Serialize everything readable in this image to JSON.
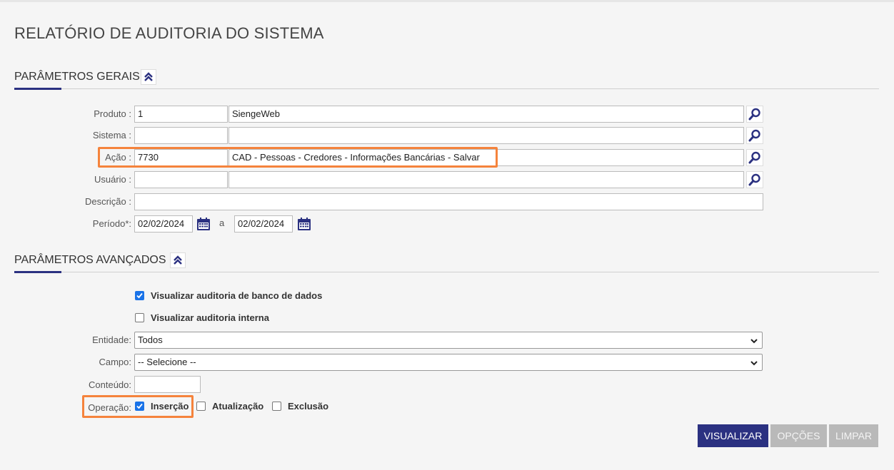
{
  "page": {
    "title": "RELATÓRIO DE AUDITORIA DO SISTEMA"
  },
  "general": {
    "title": "PARÂMETROS GERAIS",
    "produto": {
      "label": "Produto :",
      "code": "1",
      "name": "SiengeWeb"
    },
    "sistema": {
      "label": "Sistema :",
      "code": "",
      "name": ""
    },
    "acao": {
      "label": "Ação :",
      "code": "7730",
      "name": "CAD - Pessoas - Credores - Informações Bancárias - Salvar"
    },
    "usuario": {
      "label": "Usuário :",
      "code": "",
      "name": ""
    },
    "descricao": {
      "label": "Descrição :",
      "value": ""
    },
    "periodo": {
      "label": "Período*:",
      "start": "02/02/2024",
      "separator": "a",
      "end": "02/02/2024"
    }
  },
  "advanced": {
    "title": "PARÂMETROS AVANÇADOS",
    "db_audit": {
      "label": "Visualizar auditoria de banco de dados",
      "checked": true
    },
    "internal_audit": {
      "label": "Visualizar auditoria interna",
      "checked": false
    },
    "entidade": {
      "label": "Entidade:",
      "selected": "Todos"
    },
    "campo": {
      "label": "Campo:",
      "selected": "-- Selecione --"
    },
    "conteudo": {
      "label": "Conteúdo:",
      "value": ""
    },
    "operacao": {
      "label": "Operação:",
      "insercao": {
        "label": "Inserção",
        "checked": true
      },
      "atualizacao": {
        "label": "Atualização",
        "checked": false
      },
      "exclusao": {
        "label": "Exclusão",
        "checked": false
      }
    }
  },
  "buttons": {
    "visualizar": "VISUALIZAR",
    "opcoes": "OPÇÕES",
    "limpar": "LIMPAR"
  },
  "colors": {
    "primary": "#2b3181",
    "highlight": "#f5833c",
    "disabled": "#b9b9b9",
    "checkbox": "#1a73e8"
  }
}
